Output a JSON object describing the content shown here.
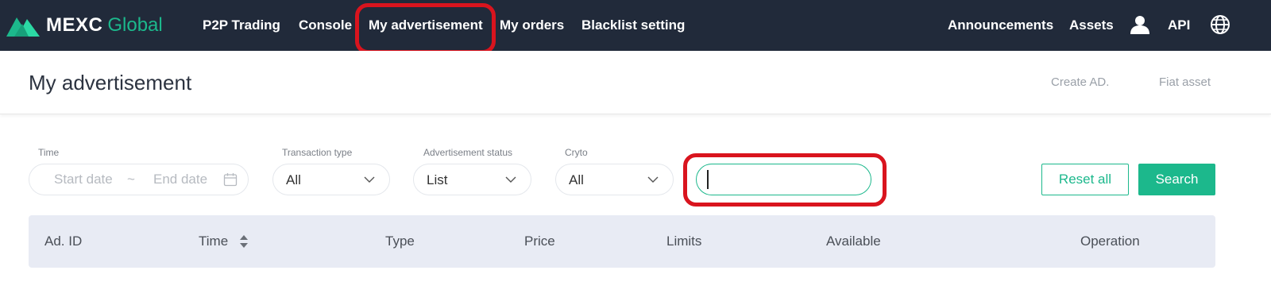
{
  "brand": {
    "name": "MEXC",
    "suffix": "Global"
  },
  "nav": {
    "items": [
      "P2P Trading",
      "Console",
      "My advertisement",
      "My orders",
      "Blacklist setting"
    ],
    "right": [
      "Announcements",
      "Assets",
      "API"
    ]
  },
  "header": {
    "title": "My advertisement",
    "create_ad": "Create AD.",
    "fiat_asset": "Fiat asset"
  },
  "filters": {
    "time_label": "Time",
    "start_placeholder": "Start date",
    "separator": "~",
    "end_placeholder": "End date",
    "transaction_type_label": "Transaction type",
    "transaction_type_value": "All",
    "status_label": "Advertisement status",
    "status_value": "List",
    "crypto_label": "Cryto",
    "crypto_value": "All",
    "ad_id_value": ""
  },
  "buttons": {
    "reset": "Reset all",
    "search": "Search"
  },
  "table": {
    "headers": [
      "Ad. ID",
      "Time",
      "Type",
      "Price",
      "Limits",
      "Available",
      "Operation"
    ]
  },
  "colors": {
    "accent": "#1cb88c",
    "topbar": "#212a3a",
    "highlight": "#d9141e",
    "table_header_bg": "#e8ebf4"
  },
  "icons": [
    "mexc-logo-icon",
    "user-icon",
    "globe-icon",
    "calendar-icon",
    "chevron-down-icon",
    "sort-icon"
  ]
}
